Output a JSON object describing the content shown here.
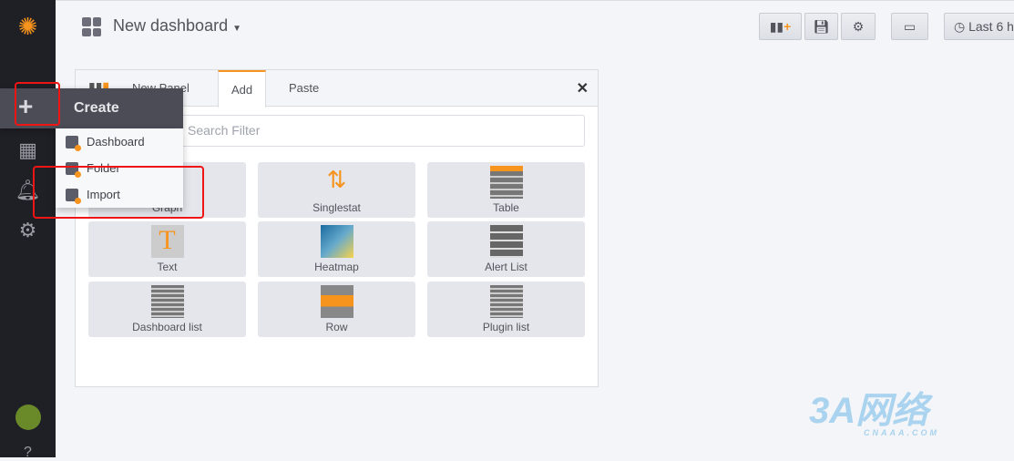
{
  "header": {
    "title": "New dashboard",
    "time_range": "Last 6 h"
  },
  "toolbar": {
    "icons": [
      "add-panel-icon",
      "save-icon",
      "settings-icon",
      "tv-mode-icon",
      "clock-icon"
    ]
  },
  "panel": {
    "tabs": [
      {
        "label": "New Panel"
      },
      {
        "label": "Add"
      },
      {
        "label": "Paste"
      }
    ],
    "active_tab": "Add",
    "filter_placeholder": "Search Filter",
    "items": [
      {
        "label": "Graph"
      },
      {
        "label": "Singlestat"
      },
      {
        "label": "Table"
      },
      {
        "label": "Text"
      },
      {
        "label": "Heatmap"
      },
      {
        "label": "Alert List"
      },
      {
        "label": "Dashboard list"
      },
      {
        "label": "Row"
      },
      {
        "label": "Plugin list"
      }
    ]
  },
  "create_menu": {
    "title": "Create",
    "items": [
      {
        "label": "Dashboard"
      },
      {
        "label": "Folder"
      },
      {
        "label": "Import"
      }
    ]
  },
  "watermark": {
    "text": "3A网络",
    "sub": "CNAAA.COM"
  },
  "colors": {
    "accent": "#f7941d",
    "sidebar": "#1f1f26",
    "highlight": "#f01515"
  }
}
